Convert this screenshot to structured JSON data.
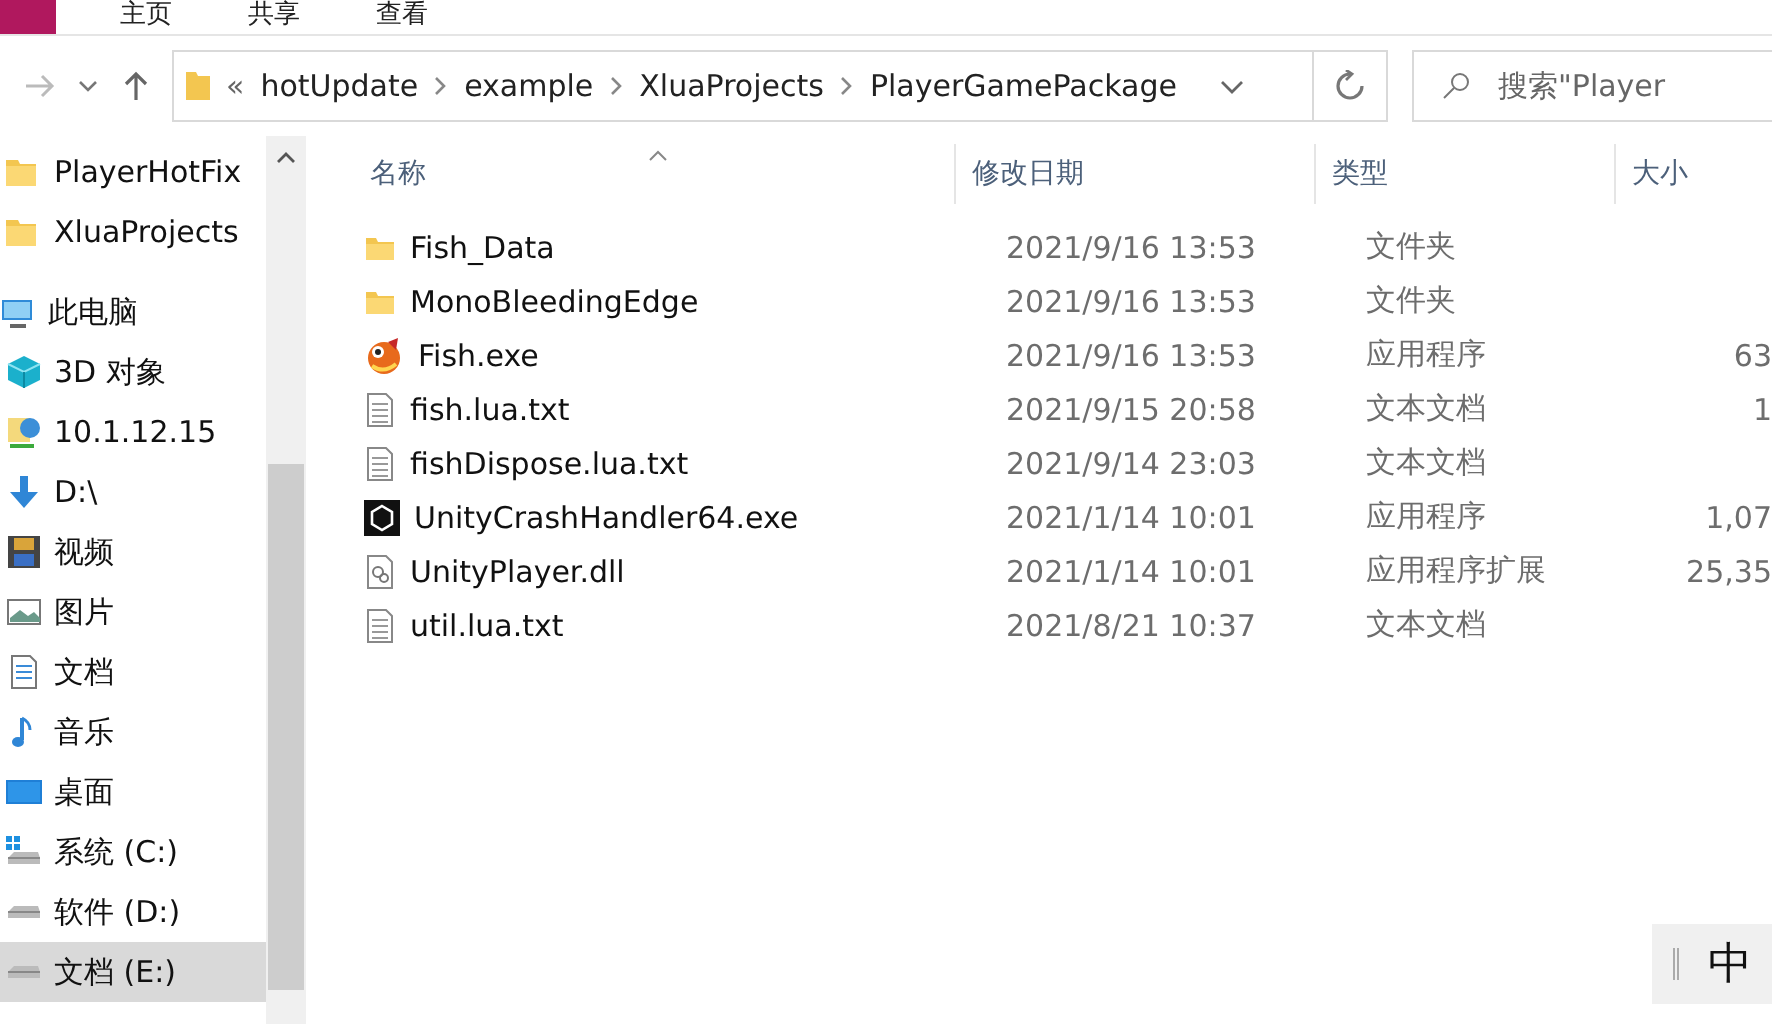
{
  "ribbon_tabs": [
    "主页",
    "共享",
    "查看"
  ],
  "address": {
    "overflow": "«",
    "crumbs": [
      "hotUpdate",
      "example",
      "XluaProjects",
      "PlayerGamePackage"
    ]
  },
  "search": {
    "placeholder": "搜索\"Player"
  },
  "sidebar": {
    "items": [
      {
        "kind": "folder",
        "label": "PlayerHotFix",
        "selected": false
      },
      {
        "kind": "folder",
        "label": "XluaProjects",
        "selected": false
      },
      {
        "kind": "pc",
        "label": "此电脑",
        "selected": false
      },
      {
        "kind": "cube",
        "label": "3D 对象",
        "selected": false
      },
      {
        "kind": "network",
        "label": "10.1.12.15",
        "selected": false
      },
      {
        "kind": "download",
        "label": "D:\\",
        "selected": false
      },
      {
        "kind": "video",
        "label": "视频",
        "selected": false
      },
      {
        "kind": "picture",
        "label": "图片",
        "selected": false
      },
      {
        "kind": "document",
        "label": "文档",
        "selected": false
      },
      {
        "kind": "music",
        "label": "音乐",
        "selected": false
      },
      {
        "kind": "desktop",
        "label": "桌面",
        "selected": false
      },
      {
        "kind": "system-drive",
        "label": "系统 (C:)",
        "selected": false
      },
      {
        "kind": "drive",
        "label": "软件 (D:)",
        "selected": false
      },
      {
        "kind": "drive",
        "label": "文档 (E:)",
        "selected": true
      }
    ]
  },
  "table": {
    "columns": [
      "名称",
      "修改日期",
      "类型",
      "大小"
    ],
    "rows": [
      {
        "kind": "folder",
        "name": "Fish_Data",
        "date": "2021/9/16 13:53",
        "type": "文件夹",
        "size": ""
      },
      {
        "kind": "folder",
        "name": "MonoBleedingEdge",
        "date": "2021/9/16 13:53",
        "type": "文件夹",
        "size": ""
      },
      {
        "kind": "game",
        "name": "Fish.exe",
        "date": "2021/9/16 13:53",
        "type": "应用程序",
        "size": "63"
      },
      {
        "kind": "text",
        "name": "fish.lua.txt",
        "date": "2021/9/15 20:58",
        "type": "文本文档",
        "size": "1"
      },
      {
        "kind": "text",
        "name": "fishDispose.lua.txt",
        "date": "2021/9/14 23:03",
        "type": "文本文档",
        "size": ""
      },
      {
        "kind": "unity",
        "name": "UnityCrashHandler64.exe",
        "date": "2021/1/14 10:01",
        "type": "应用程序",
        "size": "1,07"
      },
      {
        "kind": "dll",
        "name": "UnityPlayer.dll",
        "date": "2021/1/14 10:01",
        "type": "应用程序扩展",
        "size": "25,35"
      },
      {
        "kind": "text",
        "name": "util.lua.txt",
        "date": "2021/8/21 10:37",
        "type": "文本文档",
        "size": ""
      }
    ]
  },
  "ime": {
    "label": "中"
  }
}
